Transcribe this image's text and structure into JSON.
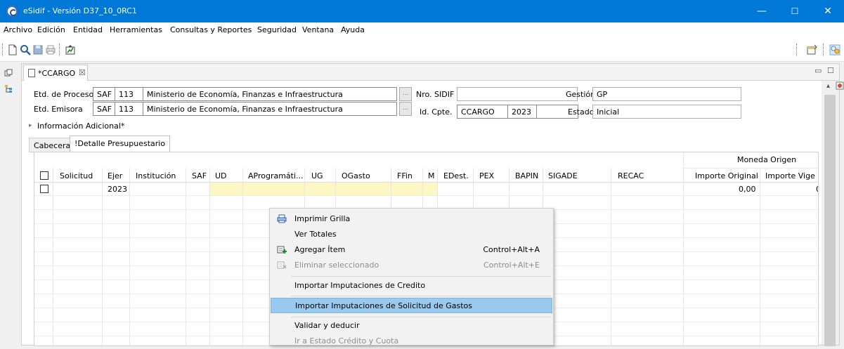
{
  "window": {
    "title": "eSidif - Versión D37_10_0RC1",
    "minimize": "—",
    "maximize": "☐",
    "close": "✕"
  },
  "menubar": [
    "Archivo",
    "Edición",
    "Entidad",
    "Herramientas",
    "Consultas y Reportes",
    "Seguridad",
    "Ventana",
    "Ayuda"
  ],
  "editor_tab": {
    "label": "*CCARGO",
    "close": "☒"
  },
  "header_form": {
    "etd_proceso": {
      "label": "Etd. de Proceso",
      "tipo": "SAF",
      "codigo": "113",
      "nombre": "Ministerio de Economía, Finanzas e Infraestructura"
    },
    "etd_emisora": {
      "label": "Etd. Emisora",
      "tipo": "SAF",
      "codigo": "113",
      "nombre": "Ministerio de Economía, Finanzas e Infraestructura"
    },
    "dots": "...",
    "nro_sidif": {
      "label": "Nro. SIDIF",
      "value": ""
    },
    "id_cpte": {
      "label": "Id. Cpte.",
      "tipo": "CCARGO",
      "anio": "2023",
      "numero": ""
    },
    "gestion": {
      "label": "Gestión",
      "value": "GP"
    },
    "estado": {
      "label": "Estado",
      "value": "Inicial"
    },
    "info_adicional": "Información Adicional*"
  },
  "subtabs": [
    "Cabecera",
    "!Detalle Presupuestario"
  ],
  "grid": {
    "group_header": "Moneda Origen",
    "columns": [
      "Solicitud",
      "Ejer",
      "Institución",
      "SAF",
      "UD",
      "AProgramáti...",
      "UG",
      "OGasto",
      "FFin",
      "M",
      "EDest.",
      "PEX",
      "BAPIN",
      "SIGADE",
      "RECAC",
      "Importe Original",
      "Importe Vige"
    ],
    "rows": [
      {
        "ejer": "2023",
        "importe_original": "0,00",
        "importe_vigente": "0"
      }
    ]
  },
  "context_menu": [
    {
      "label": "Imprimir Grilla",
      "shortcut": "",
      "icon": "printer-icon",
      "enabled": true,
      "highlighted": false
    },
    {
      "label": "Ver Totales",
      "shortcut": "",
      "icon": "",
      "enabled": true,
      "highlighted": false
    },
    {
      "label": "Agregar Ítem",
      "shortcut": "Control+Alt+A",
      "icon": "add-row-icon",
      "enabled": true,
      "highlighted": false
    },
    {
      "label": "Eliminar seleccionado",
      "shortcut": "Control+Alt+E",
      "icon": "delete-row-icon",
      "enabled": false,
      "highlighted": false
    },
    {
      "label": "Importar Imputaciones de Credito",
      "shortcut": "",
      "icon": "",
      "enabled": true,
      "highlighted": false
    },
    {
      "label": "Importar Imputaciones de Solicitud de Gastos",
      "shortcut": "",
      "icon": "",
      "enabled": true,
      "highlighted": true
    },
    {
      "label": "Validar y deducir",
      "shortcut": "",
      "icon": "",
      "enabled": true,
      "highlighted": false
    },
    {
      "label": "Ir a Estado Crédito y Cuota",
      "shortcut": "",
      "icon": "",
      "enabled": false,
      "highlighted": false
    }
  ],
  "colors": {
    "titlebar": "#0078d7",
    "highlight": "#99c9ef",
    "editable_cell": "#fdf7c4"
  }
}
